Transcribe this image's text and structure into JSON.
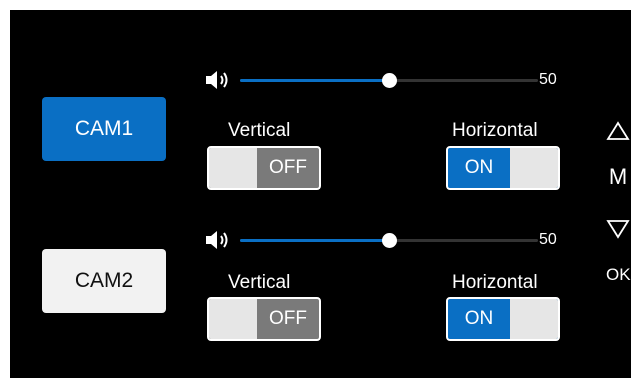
{
  "cams": [
    {
      "label": "CAM1",
      "active": true,
      "volume": 50,
      "volume_text": "50",
      "vertical_label": "Vertical",
      "vertical_state": "OFF",
      "horizontal_label": "Horizontal",
      "horizontal_state": "ON"
    },
    {
      "label": "CAM2",
      "active": false,
      "volume": 50,
      "volume_text": "50",
      "vertical_label": "Vertical",
      "vertical_state": "OFF",
      "horizontal_label": "Horizontal",
      "horizontal_state": "ON"
    }
  ],
  "side": {
    "up_icon": "triangle-up-outline-icon",
    "menu_label": "M",
    "down_icon": "triangle-down-outline-icon",
    "ok_label": "OK"
  },
  "colors": {
    "background": "#000000",
    "accent": "#0a6fc4",
    "toggle_off": "#7a7a7a",
    "inactive_button": "#f2f2f2"
  }
}
